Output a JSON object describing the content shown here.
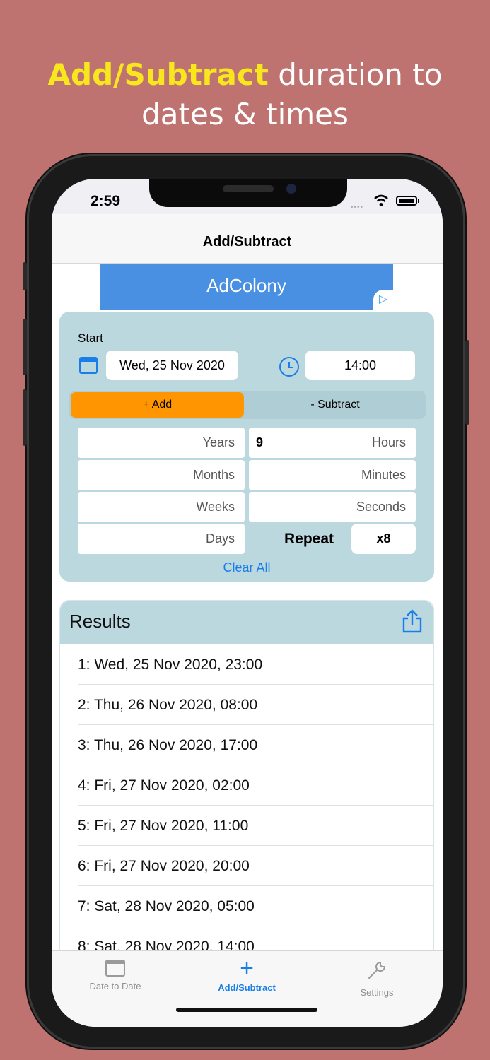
{
  "headline": {
    "highlight": "Add/Subtract",
    "rest": " duration to",
    "line2": "dates & times"
  },
  "status": {
    "time": "2:59"
  },
  "navbar": {
    "title": "Add/Subtract"
  },
  "ad": {
    "text": "AdColony"
  },
  "start": {
    "label": "Start",
    "date": "Wed, 25 Nov 2020",
    "time": "14:00"
  },
  "mode": {
    "add_label": "+ Add",
    "subtract_label": "- Subtract",
    "selected": "add"
  },
  "duration": {
    "years": {
      "label": "Years",
      "value": ""
    },
    "months": {
      "label": "Months",
      "value": ""
    },
    "weeks": {
      "label": "Weeks",
      "value": ""
    },
    "days": {
      "label": "Days",
      "value": ""
    },
    "hours": {
      "label": "Hours",
      "value": "9"
    },
    "minutes": {
      "label": "Minutes",
      "value": ""
    },
    "seconds": {
      "label": "Seconds",
      "value": ""
    }
  },
  "repeat": {
    "label": "Repeat",
    "value": "x8"
  },
  "clear_all": "Clear All",
  "results": {
    "title": "Results",
    "items": [
      "1: Wed, 25 Nov 2020, 23:00",
      "2: Thu, 26 Nov 2020, 08:00",
      "3: Thu, 26 Nov 2020, 17:00",
      "4: Fri, 27 Nov 2020, 02:00",
      "5: Fri, 27 Nov 2020, 11:00",
      "6: Fri, 27 Nov 2020, 20:00",
      "7: Sat, 28 Nov 2020, 05:00",
      "8: Sat, 28 Nov 2020, 14:00"
    ]
  },
  "tabs": [
    {
      "label": "Date to Date",
      "icon": "calendar-icon",
      "active": false
    },
    {
      "label": "Add/Subtract",
      "icon": "plus-icon",
      "active": true
    },
    {
      "label": "Settings",
      "icon": "wrench-icon",
      "active": false
    }
  ],
  "colors": {
    "background": "#bf7371",
    "accent": "#1a7ee8",
    "add_selected": "#ff9500",
    "card": "#bcd8df",
    "headline_highlight": "#f8e71c"
  }
}
